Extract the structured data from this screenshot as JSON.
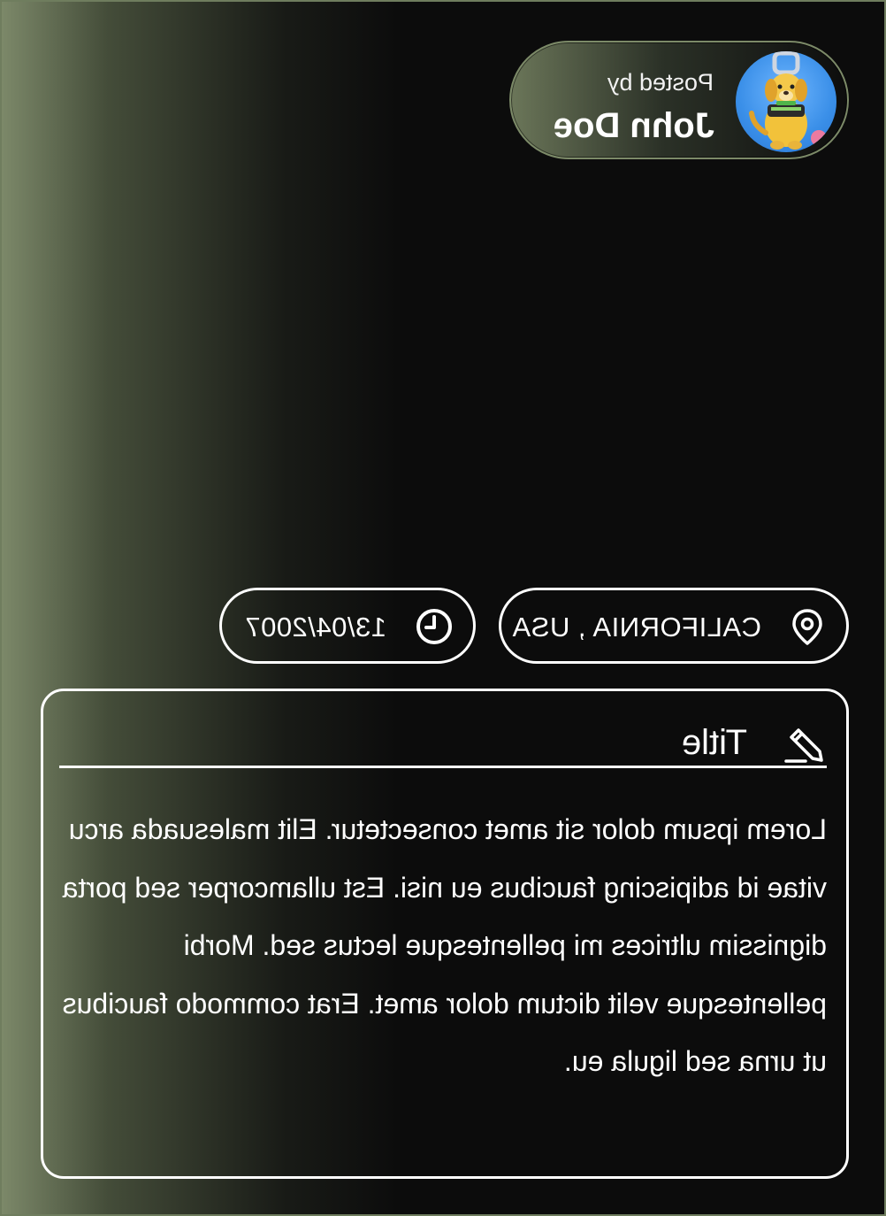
{
  "author": {
    "posted_label": "Posted by",
    "name": "John Doe"
  },
  "meta": {
    "location": "CALIFORNIA , USA",
    "date": "13/04/2007",
    "location_icon": "map-pin-icon",
    "date_icon": "clock-icon"
  },
  "post": {
    "edit_icon": "pencil-icon",
    "title": "Title",
    "body": "Lorem ipsum dolor sit amet consectetur. Elit malesuada arcu vitae id adipiscing faucibus eu nisi. Est ullamcorper sed porta dignissim ultrices mi pellentesque lectus sed. Morbi pellentesque velit dictum dolor amet. Erat commodo faucibus ut urna sed ligula eu."
  },
  "colors": {
    "background": "#0c0c0c",
    "gradient_accent": "#7f8b6b",
    "text": "#ffffff"
  }
}
